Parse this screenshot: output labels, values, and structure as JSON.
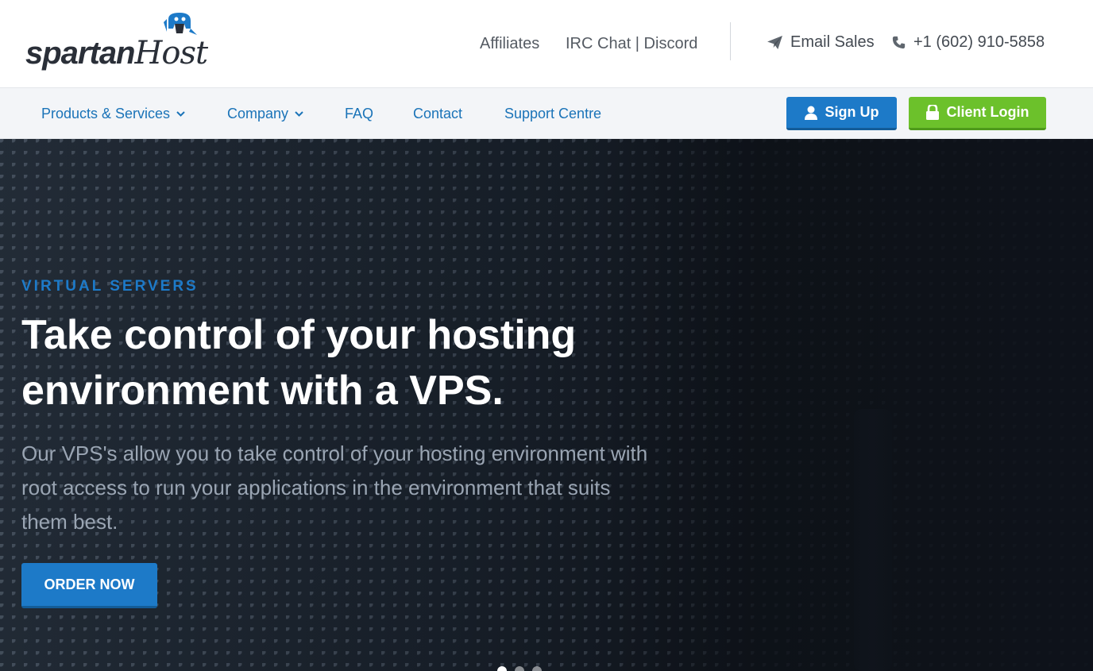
{
  "brand": {
    "word1": "spartan",
    "word2": "Host"
  },
  "topbar": {
    "affiliates": "Affiliates",
    "irc_chat": "IRC Chat | Discord",
    "email_sales": "Email Sales",
    "phone": "+1 (602) 910-5858"
  },
  "nav": {
    "items": [
      {
        "label": "Products & Services",
        "dropdown": true
      },
      {
        "label": "Company",
        "dropdown": true
      },
      {
        "label": "FAQ",
        "dropdown": false
      },
      {
        "label": "Contact",
        "dropdown": false
      },
      {
        "label": "Support Centre",
        "dropdown": false
      }
    ],
    "signup": "Sign Up",
    "login": "Client Login"
  },
  "hero": {
    "kicker": "VIRTUAL SERVERS",
    "headline": "Take control of your hosting environment with a VPS.",
    "description": "Our VPS's allow you to take control of your hosting environment with root access to run your applications in the environment that suits them best.",
    "cta": "ORDER NOW"
  },
  "colors": {
    "accent": "#1d7ac8",
    "login_green": "#6cc12b",
    "nav_text": "#1a73b8"
  },
  "icons": [
    "paper-plane-icon",
    "phone-icon",
    "user-icon",
    "lock-icon",
    "chevron-down-icon"
  ]
}
